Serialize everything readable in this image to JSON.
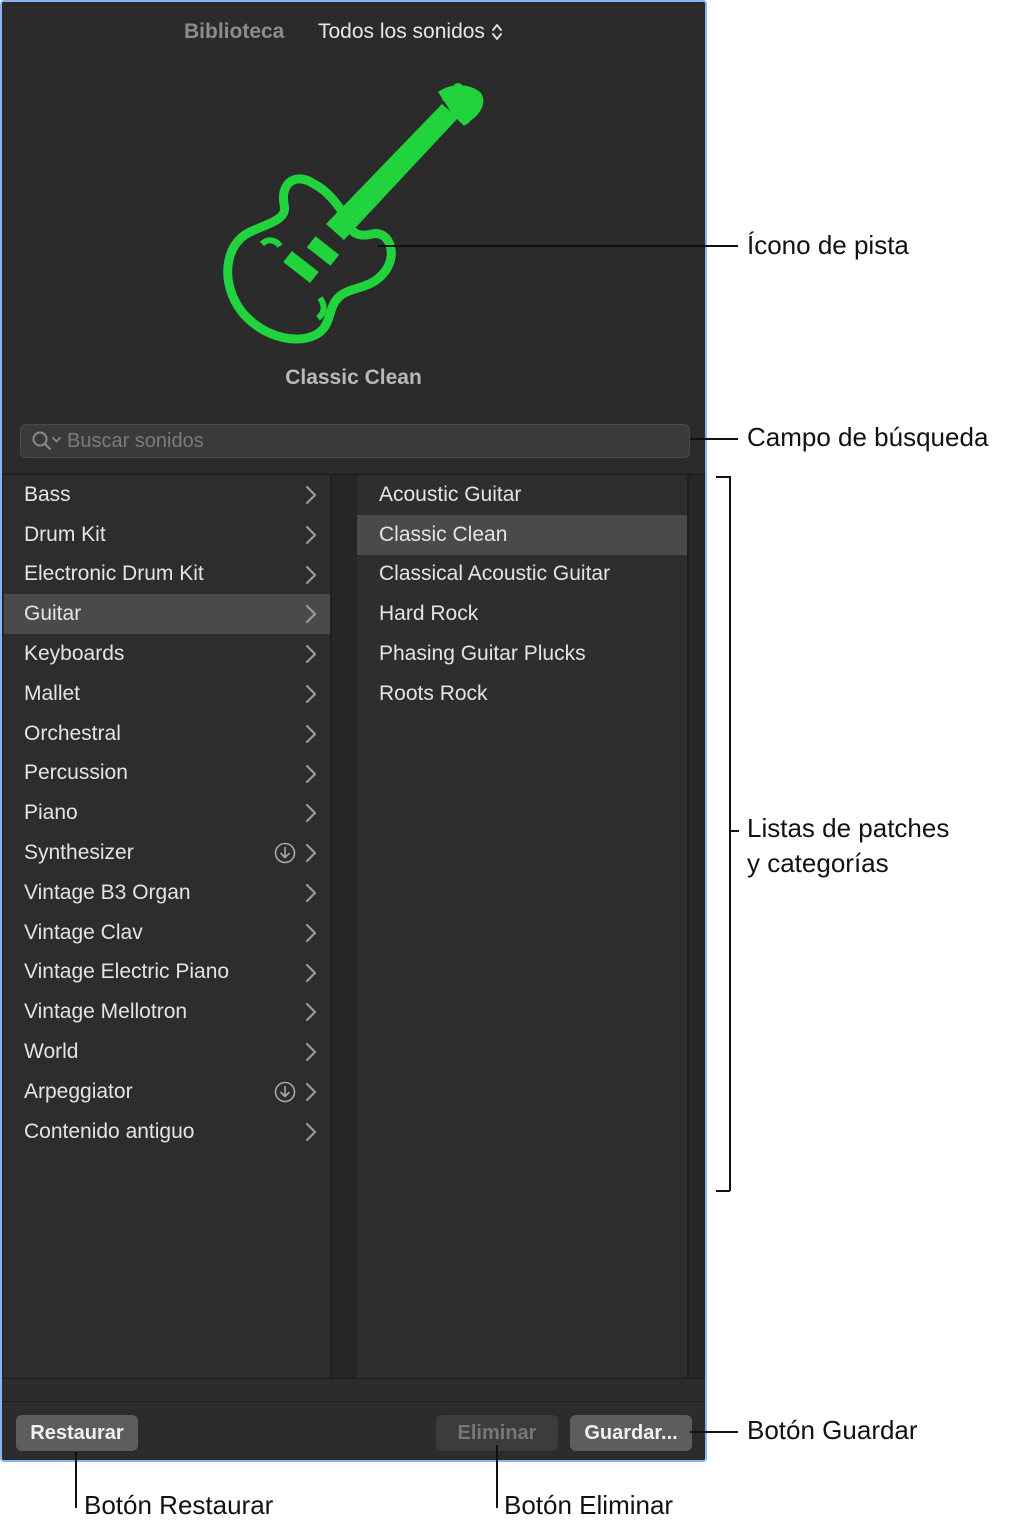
{
  "header": {
    "library_label": "Biblioteca",
    "library_selector": "Todos los sonidos",
    "patch_name": "Classic Clean",
    "track_icon": "guitar-icon",
    "accent_color": "#21d33c"
  },
  "search": {
    "placeholder": "Buscar sonidos"
  },
  "categories": [
    {
      "label": "Bass"
    },
    {
      "label": "Drum Kit"
    },
    {
      "label": "Electronic Drum Kit"
    },
    {
      "label": "Guitar"
    },
    {
      "label": "Keyboards"
    },
    {
      "label": "Mallet"
    },
    {
      "label": "Orchestral"
    },
    {
      "label": "Percussion"
    },
    {
      "label": "Piano"
    },
    {
      "label": "Synthesizer"
    },
    {
      "label": "Vintage B3 Organ"
    },
    {
      "label": "Vintage Clav"
    },
    {
      "label": "Vintage Electric Piano"
    },
    {
      "label": "Vintage Mellotron"
    },
    {
      "label": "World"
    },
    {
      "label": "Arpeggiator"
    },
    {
      "label": "Contenido antiguo"
    }
  ],
  "selected_category": "Guitar",
  "patches": [
    {
      "label": "Acoustic Guitar"
    },
    {
      "label": "Classic Clean"
    },
    {
      "label": "Classical Acoustic Guitar"
    },
    {
      "label": "Hard Rock"
    },
    {
      "label": "Phasing Guitar Plucks"
    },
    {
      "label": "Roots Rock"
    }
  ],
  "selected_patch": "Classic Clean",
  "footer": {
    "restore_label": "Restaurar",
    "delete_label": "Eliminar",
    "save_label": "Guardar..."
  },
  "callouts": {
    "track_icon": "Ícono de pista",
    "search_field": "Campo de búsqueda",
    "lists_line1": "Listas de patches",
    "lists_line2": "y categorías",
    "save_button": "Botón Guardar",
    "restore_button": "Botón Restaurar",
    "delete_button": "Botón Eliminar"
  }
}
